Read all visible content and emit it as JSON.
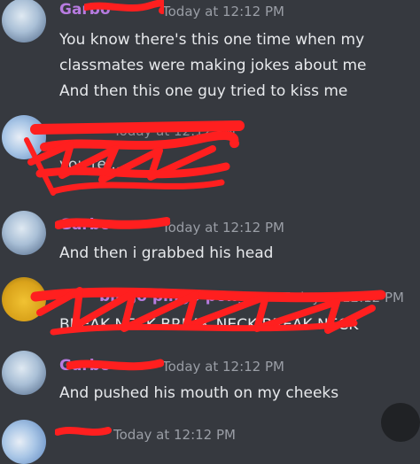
{
  "messages": [
    {
      "author": "Garbo",
      "timestamp": "Today at 12:12 PM",
      "lines": [
        "You know there's this one time when my",
        "classmates were making jokes about me",
        "And then this one guy tried to kiss me"
      ],
      "name_color": "#b77be0"
    },
    {
      "author": "",
      "timestamp": "Today at 12:12 PM",
      "lines": [
        "you're ..."
      ],
      "name_color": "#d43b3b"
    },
    {
      "author": "Garbo",
      "timestamp": "Today at 12:12 PM",
      "lines": [
        "And then i grabbed his head"
      ],
      "name_color": "#b77be0"
    },
    {
      "author": "bingo pingo pongo",
      "timestamp": "Today at 12:12 PM",
      "lines": [
        "BREAK NECK BREAK NECK BREAK NECK"
      ],
      "name_color": "#b77be0"
    },
    {
      "author": "Garbo",
      "timestamp": "Today at 12:12 PM",
      "lines": [
        "And pushed his mouth on my cheeks"
      ],
      "name_color": "#b77be0"
    },
    {
      "author": "",
      "timestamp": "Today at 12:12 PM",
      "lines": [],
      "name_color": "#b77be0"
    }
  ],
  "redaction_color": "#ff1f1f"
}
